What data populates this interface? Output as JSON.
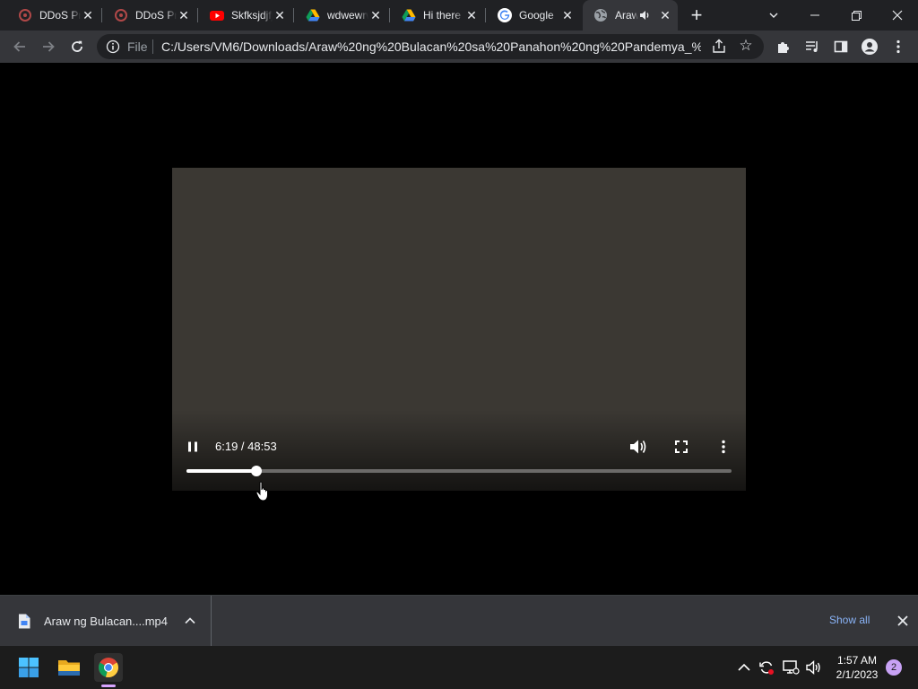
{
  "tabs": [
    {
      "title": "DDoS Protection",
      "icon": "ddos-icon"
    },
    {
      "title": "DDoS Protection",
      "icon": "ddos-icon"
    },
    {
      "title": "Skfksjdjfj",
      "icon": "youtube-icon"
    },
    {
      "title": "wdwewrwer",
      "icon": "google-drive-icon"
    },
    {
      "title": "Hi there",
      "icon": "google-drive-icon"
    },
    {
      "title": "Google",
      "icon": "google-icon"
    },
    {
      "title": "Araw ng Bulacan",
      "icon": "globe-icon",
      "active": true,
      "audio": true
    }
  ],
  "toolbar": {
    "scheme": "File",
    "url": "C:/Users/VM6/Downloads/Araw%20ng%20Bulacan%20sa%20Panahon%20ng%20Pandemya_%2..."
  },
  "video": {
    "current_time": "6:19",
    "duration": "48:53",
    "time_display": "6:19 / 48:53",
    "progress": 0.129,
    "state": "playing"
  },
  "download": {
    "filename": "Araw ng Bulacan....mp4",
    "show_all": "Show all"
  },
  "taskbar": {
    "time": "1:57 AM",
    "date": "2/1/2023",
    "notifications": "2"
  },
  "colors": {
    "tabstrip": "#202124",
    "toolbar": "#35363a",
    "link": "#8ab4f8",
    "taskbar": "#1c1c1c",
    "badge": "#c8a2f5"
  }
}
